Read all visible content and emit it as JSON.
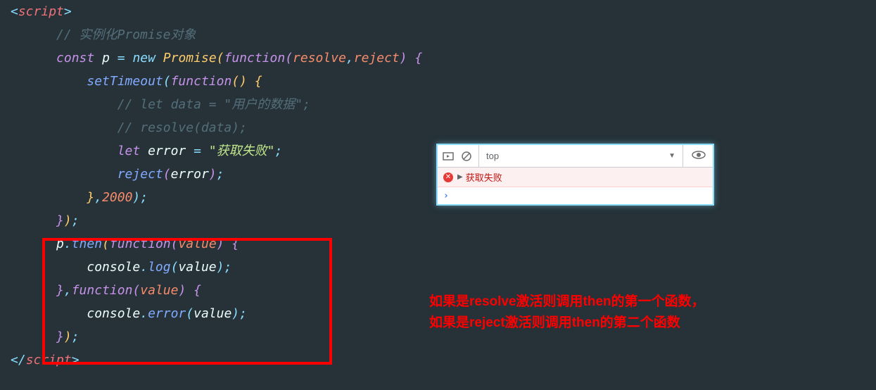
{
  "code": {
    "line1_open": "<",
    "line1_tag": "script",
    "line1_close": ">",
    "line2_comment": "// 实例化Promise对象",
    "line3_const": "const",
    "line3_var": "p",
    "line3_eq": "=",
    "line3_new": "new",
    "line3_class": "Promise",
    "line3_func": "function",
    "line3_p1": "resolve",
    "line3_p2": "reject",
    "line4_func": "setTimeout",
    "line4_kw": "function",
    "line5_comment": "// let data = \"用户的数据\";",
    "line6_comment": "// resolve(data);",
    "line7_let": "let",
    "line7_var": "error",
    "line7_eq": "=",
    "line7_str": "\"获取失败\"",
    "line8_func": "reject",
    "line8_arg": "error",
    "line9_num": "2000",
    "line11_var": "p",
    "line11_method": "then",
    "line11_kw": "function",
    "line11_param": "value",
    "line12_obj": "console",
    "line12_method": "log",
    "line12_arg": "value",
    "line13_kw": "function",
    "line13_param": "value",
    "line14_obj": "console",
    "line14_method": "error",
    "line14_arg": "value",
    "line16_open": "</",
    "line16_tag": "script",
    "line16_close": ">"
  },
  "console": {
    "context": "top",
    "error_message": "获取失败"
  },
  "annotation": {
    "line1": "如果是resolve激活则调用then的第一个函数，",
    "line2": "如果是reject激活则调用then的第二个函数"
  }
}
